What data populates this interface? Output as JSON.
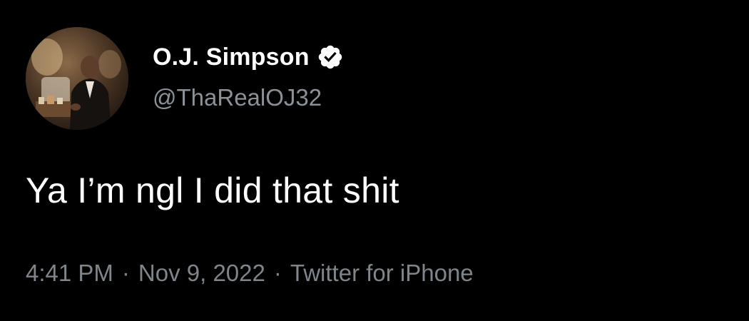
{
  "tweet": {
    "display_name": "O.J. Simpson",
    "handle": "@ThaRealOJ32",
    "text": "Ya I’m ngl I did that shit",
    "time": "4:41 PM",
    "separator": "·",
    "date": "Nov 9, 2022",
    "source": "Twitter for iPhone",
    "verified_icon": "verified-badge-icon",
    "verified_color": "#ffffff"
  }
}
